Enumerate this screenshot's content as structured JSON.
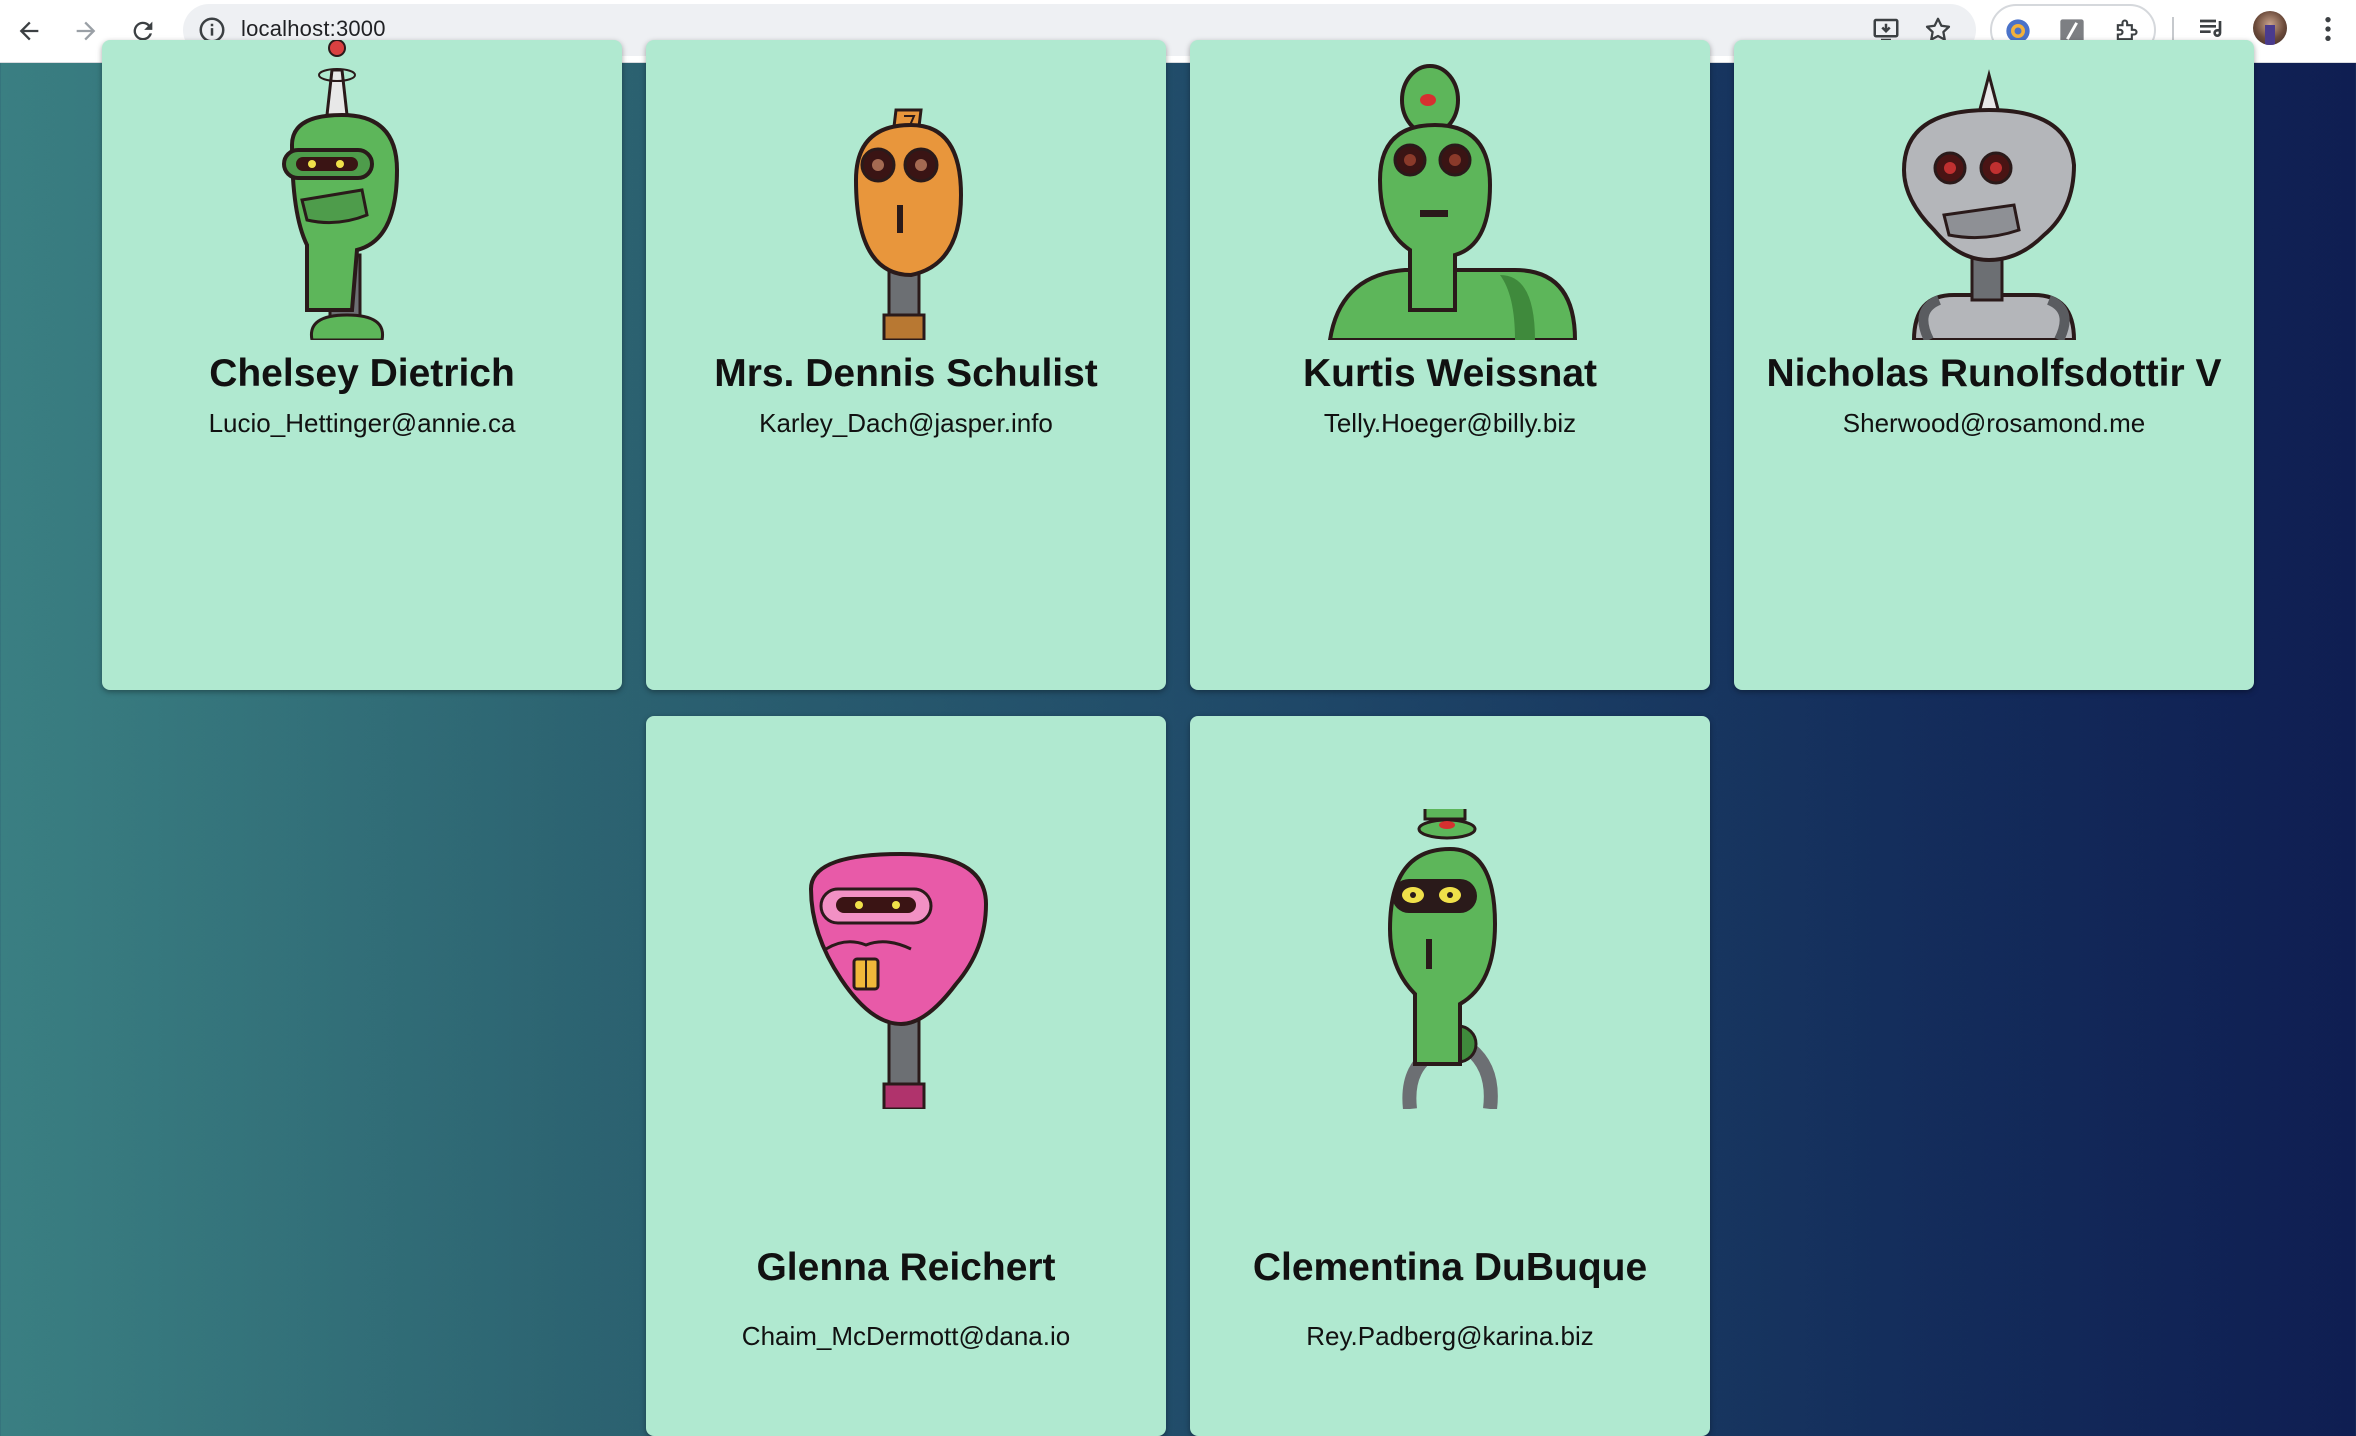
{
  "browser": {
    "url": "localhost:3000",
    "back_icon": "arrow-left-icon",
    "forward_icon": "arrow-right-icon",
    "reload_icon": "reload-icon",
    "site_info_icon": "info-icon",
    "install_icon": "install-app-icon",
    "bookmark_icon": "star-icon",
    "extensions": [
      "color-extension-icon",
      "slash-extension-icon",
      "puzzle-extensions-icon"
    ],
    "media_icon": "media-queue-icon",
    "profile_icon": "avatar",
    "menu_icon": "kebab-menu-icon"
  },
  "robots": [
    {
      "name": "Chelsey Dietrich",
      "email": "Lucio_Hettinger@annie.ca",
      "color": "#5db65a"
    },
    {
      "name": "Mrs. Dennis Schulist",
      "email": "Karley_Dach@jasper.info",
      "color": "#e8963c"
    },
    {
      "name": "Kurtis Weissnat",
      "email": "Telly.Hoeger@billy.biz",
      "color": "#5db65a"
    },
    {
      "name": "Nicholas Runolfsdottir V",
      "email": "Sherwood@rosamond.me",
      "color": "#b4b6ba"
    },
    {
      "name": "Glenna Reichert",
      "email": "Chaim_McDermott@dana.io",
      "color": "#e85aa8"
    },
    {
      "name": "Clementina DuBuque",
      "email": "Rey.Padberg@karina.biz",
      "color": "#5db65a"
    }
  ],
  "colors": {
    "card_bg": "#b0e9d0",
    "page_gradient_start": "#3a7f82",
    "page_gradient_end": "#0f1e52"
  }
}
